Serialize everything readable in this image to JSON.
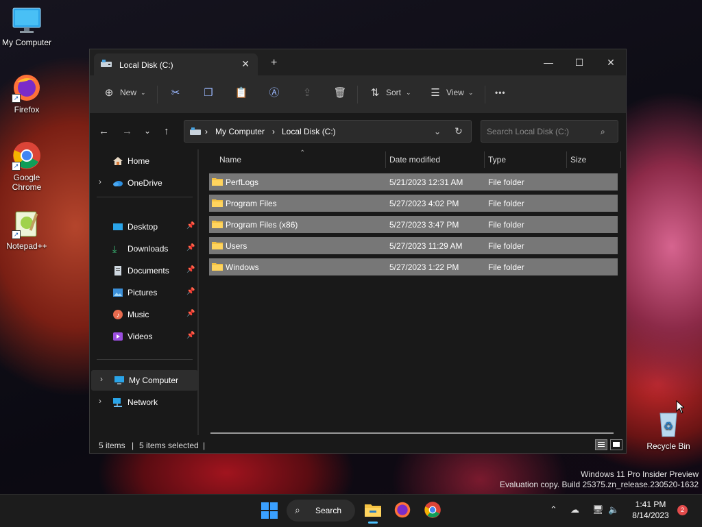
{
  "desktop": {
    "icons": [
      {
        "label": "My Computer"
      },
      {
        "label": "Firefox"
      },
      {
        "label": "Google Chrome"
      },
      {
        "label": "Notepad++"
      },
      {
        "label": "Recycle Bin"
      }
    ],
    "watermark_line1": "Windows 11 Pro Insider Preview",
    "watermark_line2": "Evaluation copy. Build 25375.zn_release.230520-1632"
  },
  "window": {
    "tab_title": "Local Disk (C:)",
    "tab_close": "✕",
    "new_tab": "+",
    "minimize": "—",
    "maximize": "☐",
    "close": "✕",
    "toolbar": {
      "new_label": "New",
      "sort_label": "Sort",
      "view_label": "View",
      "more_label": "•••"
    },
    "address": {
      "crumbs": [
        "My Computer",
        "Local Disk (C:)"
      ],
      "separator": "›",
      "search_placeholder": "Search Local Disk (C:)"
    },
    "nav_pane": {
      "items": [
        {
          "label": "Home",
          "icon": "home-icon"
        },
        {
          "label": "OneDrive",
          "icon": "onedrive-icon"
        },
        {
          "label": "Desktop",
          "icon": "desktop-icon"
        },
        {
          "label": "Downloads",
          "icon": "downloads-icon"
        },
        {
          "label": "Documents",
          "icon": "documents-icon"
        },
        {
          "label": "Pictures",
          "icon": "pictures-icon"
        },
        {
          "label": "Music",
          "icon": "music-icon"
        },
        {
          "label": "Videos",
          "icon": "videos-icon"
        },
        {
          "label": "My Computer",
          "icon": "computer-icon"
        },
        {
          "label": "Network",
          "icon": "network-icon"
        }
      ]
    },
    "columns": [
      "Name",
      "Date modified",
      "Type",
      "Size"
    ],
    "files": [
      {
        "name": "PerfLogs",
        "date": "5/21/2023 12:31 AM",
        "type": "File folder",
        "size": ""
      },
      {
        "name": "Program Files",
        "date": "5/27/2023 4:02 PM",
        "type": "File folder",
        "size": ""
      },
      {
        "name": "Program Files (x86)",
        "date": "5/27/2023 3:47 PM",
        "type": "File folder",
        "size": ""
      },
      {
        "name": "Users",
        "date": "5/27/2023 11:29 AM",
        "type": "File folder",
        "size": ""
      },
      {
        "name": "Windows",
        "date": "5/27/2023 1:22 PM",
        "type": "File folder",
        "size": ""
      }
    ],
    "status": {
      "items": "5 items",
      "divider": "|",
      "selected": "5 items selected"
    }
  },
  "taskbar": {
    "search_label": "Search",
    "clock_time": "1:41 PM",
    "clock_date": "8/14/2023",
    "notification_count": "2"
  },
  "colors": {
    "selection": "#777777",
    "accent": "#4cc2ff",
    "folder": "#f5c242"
  }
}
